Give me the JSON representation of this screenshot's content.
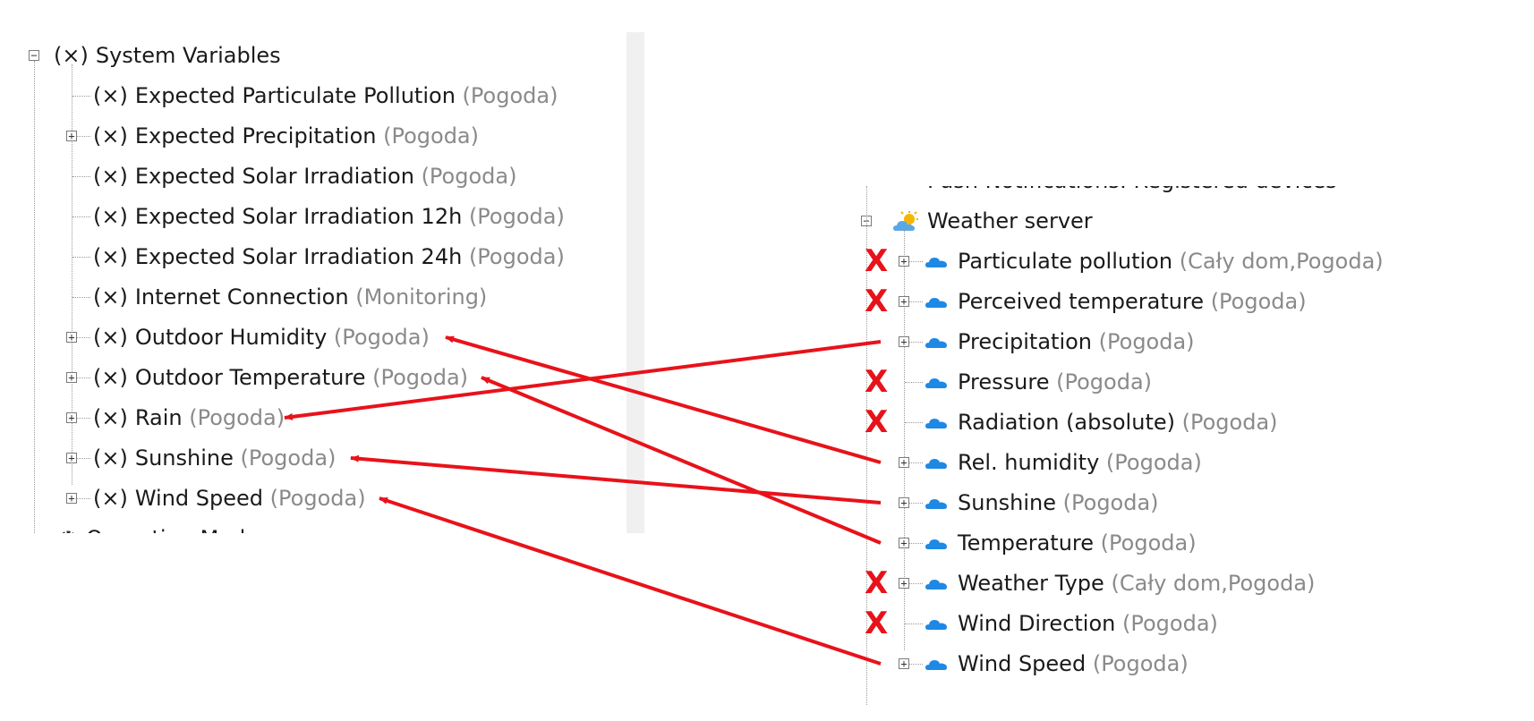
{
  "left_tree": {
    "root_label": "System Variables",
    "root_icon": "variable-x-icon",
    "variable_glyph": "(×)",
    "items": [
      {
        "label": "Expected Particulate Pollution",
        "group": "(Pogoda)",
        "expandable": false
      },
      {
        "label": "Expected Precipitation",
        "group": "(Pogoda)",
        "expandable": true
      },
      {
        "label": "Expected Solar Irradiation",
        "group": "(Pogoda)",
        "expandable": false
      },
      {
        "label": "Expected Solar Irradiation 12h",
        "group": "(Pogoda)",
        "expandable": false
      },
      {
        "label": "Expected Solar Irradiation 24h",
        "group": "(Pogoda)",
        "expandable": false
      },
      {
        "label": "Internet Connection",
        "group": "(Monitoring)",
        "expandable": false
      },
      {
        "label": "Outdoor Humidity",
        "group": "(Pogoda)",
        "expandable": true
      },
      {
        "label": "Outdoor Temperature",
        "group": "(Pogoda)",
        "expandable": true
      },
      {
        "label": "Rain",
        "group": "(Pogoda)",
        "expandable": true
      },
      {
        "label": "Sunshine",
        "group": "(Pogoda)",
        "expandable": true
      },
      {
        "label": "Wind Speed",
        "group": "(Pogoda)",
        "expandable": true
      }
    ],
    "next_section_label": "Operating Modes",
    "next_section_icon": "gear-icon"
  },
  "right_tree": {
    "partial_top_label": "Push Notifications: Registered devices",
    "root_label": "Weather server",
    "root_icon": "sun-cloud-icon",
    "items": [
      {
        "label": "Particulate pollution",
        "group": "(Cały dom,Pogoda)",
        "expandable": true,
        "crossed": true
      },
      {
        "label": "Perceived temperature",
        "group": "(Pogoda)",
        "expandable": true,
        "crossed": true
      },
      {
        "label": "Precipitation",
        "group": "(Pogoda)",
        "expandable": true,
        "crossed": false
      },
      {
        "label": "Pressure",
        "group": "(Pogoda)",
        "expandable": false,
        "crossed": true
      },
      {
        "label": "Radiation (absolute)",
        "group": "(Pogoda)",
        "expandable": false,
        "crossed": true
      },
      {
        "label": "Rel. humidity",
        "group": "(Pogoda)",
        "expandable": true,
        "crossed": false
      },
      {
        "label": "Sunshine",
        "group": "(Pogoda)",
        "expandable": true,
        "crossed": false
      },
      {
        "label": "Temperature",
        "group": "(Pogoda)",
        "expandable": true,
        "crossed": false
      },
      {
        "label": "Weather Type",
        "group": "(Cały dom,Pogoda)",
        "expandable": true,
        "crossed": true
      },
      {
        "label": "Wind Direction",
        "group": "(Pogoda)",
        "expandable": false,
        "crossed": true
      },
      {
        "label": "Wind Speed",
        "group": "(Pogoda)",
        "expandable": true,
        "crossed": false
      }
    ],
    "item_icon": "cloud-icon"
  },
  "annotations": {
    "cross_mark": "X",
    "arrow_color": "#e8121a",
    "mappings": [
      {
        "from": "Precipitation",
        "to": "Rain"
      },
      {
        "from": "Rel. humidity",
        "to": "Outdoor Humidity"
      },
      {
        "from": "Sunshine",
        "to": "Sunshine"
      },
      {
        "from": "Temperature",
        "to": "Outdoor Temperature"
      },
      {
        "from": "Wind Speed",
        "to": "Wind Speed"
      }
    ]
  },
  "colors": {
    "group_text": "#8a8a8a",
    "cloud": "#1e88e5",
    "sun": "#f7b500",
    "annotation_red": "#e8121a"
  }
}
